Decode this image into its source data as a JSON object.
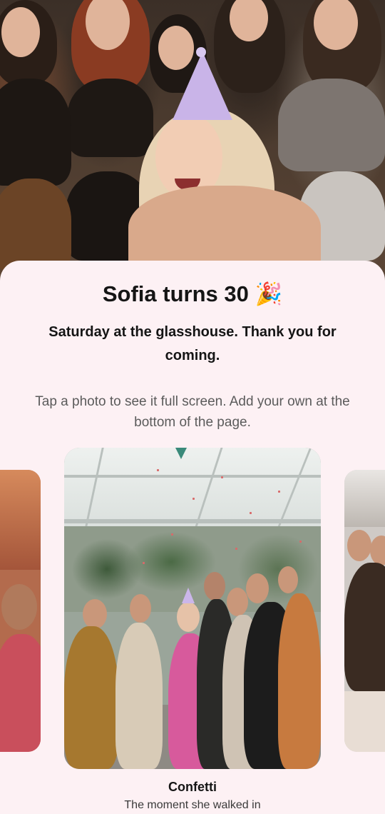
{
  "header": {
    "title": "Sofia turns 30",
    "title_emoji": "🎉",
    "subtitle": "Saturday at the glasshouse. Thank you for coming.",
    "hint": "Tap a photo to see it full screen. Add your own at the bottom of the page."
  },
  "gallery": {
    "current": {
      "title": "Confetti",
      "caption": "The moment she walked in"
    }
  },
  "colors": {
    "sheet_background": "#fdf1f4",
    "party_hat": "#c9b4e8",
    "text_primary": "#151515",
    "text_secondary": "#5b5b5b"
  }
}
